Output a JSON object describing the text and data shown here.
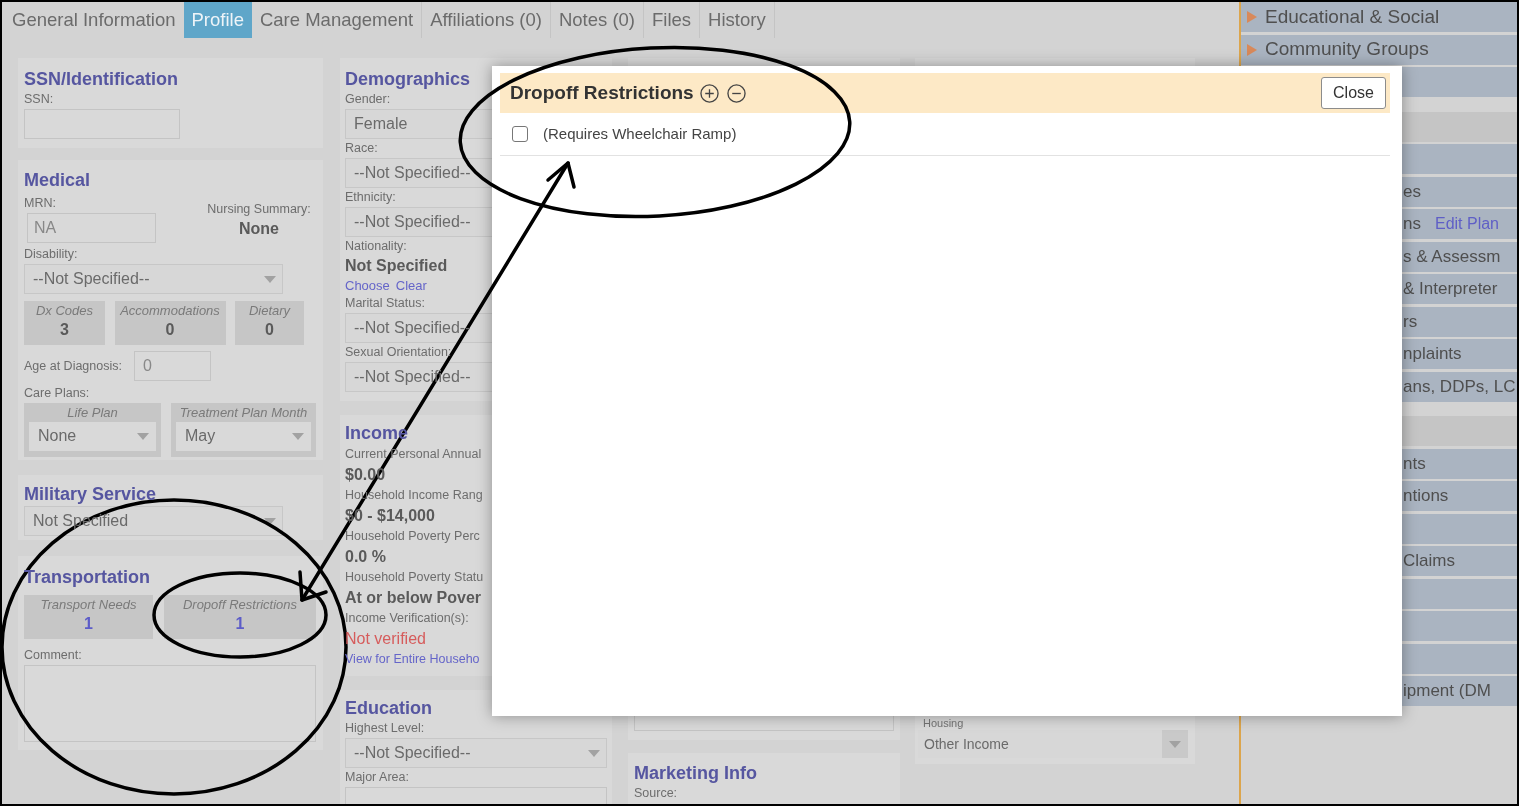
{
  "tabs": [
    {
      "label": "General Information",
      "selected": false
    },
    {
      "label": "Profile",
      "selected": true
    },
    {
      "label": "Care Management",
      "selected": false
    },
    {
      "label": "Affiliations (0)",
      "selected": false
    },
    {
      "label": "Notes (0)",
      "selected": false
    },
    {
      "label": "Files",
      "selected": false
    },
    {
      "label": "History",
      "selected": false
    }
  ],
  "ssn_identification": {
    "title": "SSN/Identification",
    "ssn_label": "SSN:"
  },
  "medical": {
    "title": "Medical",
    "mrn_label": "MRN:",
    "mrn_value": "NA",
    "nursing_summary_label": "Nursing Summary:",
    "nursing_summary_value": "None",
    "disability_label": "Disability:",
    "disability_value": "--Not Specified--",
    "counters": [
      {
        "label": "Dx Codes",
        "value": "3",
        "kind": "count"
      },
      {
        "label": "Accommodations",
        "value": "0",
        "kind": "count"
      },
      {
        "label": "Dietary",
        "value": "0",
        "kind": "count"
      }
    ],
    "age_at_diagnosis_label": "Age at Diagnosis:",
    "age_at_diagnosis_value": "0",
    "care_plans_label": "Care Plans:",
    "care_plans": [
      {
        "label": "Life Plan",
        "value": "None"
      },
      {
        "label": "Treatment Plan Month",
        "value": "May"
      }
    ]
  },
  "military_service": {
    "title": "Military Service",
    "value": "Not Specified"
  },
  "transportation": {
    "title": "Transportation",
    "counters": [
      {
        "label": "Transport Needs",
        "value": "1",
        "kind": "link"
      },
      {
        "label": "Dropoff Restrictions",
        "value": "1",
        "kind": "link"
      }
    ],
    "comment_label": "Comment:"
  },
  "demographics": {
    "title": "Demographics",
    "fields": [
      {
        "kind": "select",
        "label": "Gender:",
        "value": "Female"
      },
      {
        "kind": "select",
        "label": "Race:",
        "value": "--Not Specified--"
      },
      {
        "kind": "select",
        "label": "Ethnicity:",
        "value": "--Not Specified--"
      },
      {
        "kind": "text",
        "label": "Nationality:",
        "value": "Not Specified",
        "links": [
          "Choose",
          "Clear"
        ]
      },
      {
        "kind": "select",
        "label": "Marital Status:",
        "value": "--Not Specified--"
      },
      {
        "kind": "select",
        "label": "Sexual Orientation:",
        "value": "--Not Specified--"
      }
    ]
  },
  "income": {
    "title": "Income",
    "fields": [
      {
        "label": "Current Personal Annual",
        "value": "$0.00"
      },
      {
        "label": "Household Income Rang",
        "value": "$0 - $14,000"
      },
      {
        "label": "Household Poverty Perc",
        "value": "0.0 %"
      },
      {
        "label": "Household Poverty Statu",
        "value": "At or below Pover"
      },
      {
        "label": "Income Verification(s):",
        "value": "Not verified",
        "verified": false
      }
    ],
    "link": "View for Entire Househo"
  },
  "education": {
    "title": "Education",
    "fields": [
      {
        "kind": "select",
        "label": "Highest Level:",
        "value": "--Not Specified--"
      },
      {
        "kind": "input",
        "label": "Major Area:"
      }
    ]
  },
  "housing": {
    "label": "Housing",
    "value": "Other Income"
  },
  "marketing_info": {
    "title": "Marketing Info",
    "source_label": "Source:"
  },
  "sidebar": {
    "items": [
      {
        "kind": "group",
        "label": "Educational & Social",
        "expanded": false
      },
      {
        "kind": "group",
        "label": "Community Groups",
        "expanded": false
      },
      {
        "kind": "item"
      },
      {
        "kind": "header"
      },
      {
        "kind": "item"
      },
      {
        "kind": "item",
        "label": "es"
      },
      {
        "kind": "item",
        "label": "ns",
        "link": "Edit Plan"
      },
      {
        "kind": "item",
        "label": "s & Assessm"
      },
      {
        "kind": "item",
        "label": "& Interpreter"
      },
      {
        "kind": "item",
        "label": "rs"
      },
      {
        "kind": "item",
        "label": "nplaints"
      },
      {
        "kind": "item",
        "label": "ans, DDPs, LC"
      },
      {
        "kind": "header"
      },
      {
        "kind": "item",
        "label": "nts"
      },
      {
        "kind": "item",
        "label": "ntions"
      },
      {
        "kind": "item"
      },
      {
        "kind": "item",
        "label": "Claims"
      },
      {
        "kind": "item"
      },
      {
        "kind": "item"
      },
      {
        "kind": "item"
      },
      {
        "kind": "item",
        "label": "ipment (DM"
      }
    ]
  },
  "modal": {
    "title": "Dropoff Restrictions",
    "close_label": "Close",
    "options": [
      {
        "label": "(Requires Wheelchair Ramp)",
        "checked": false
      }
    ]
  }
}
